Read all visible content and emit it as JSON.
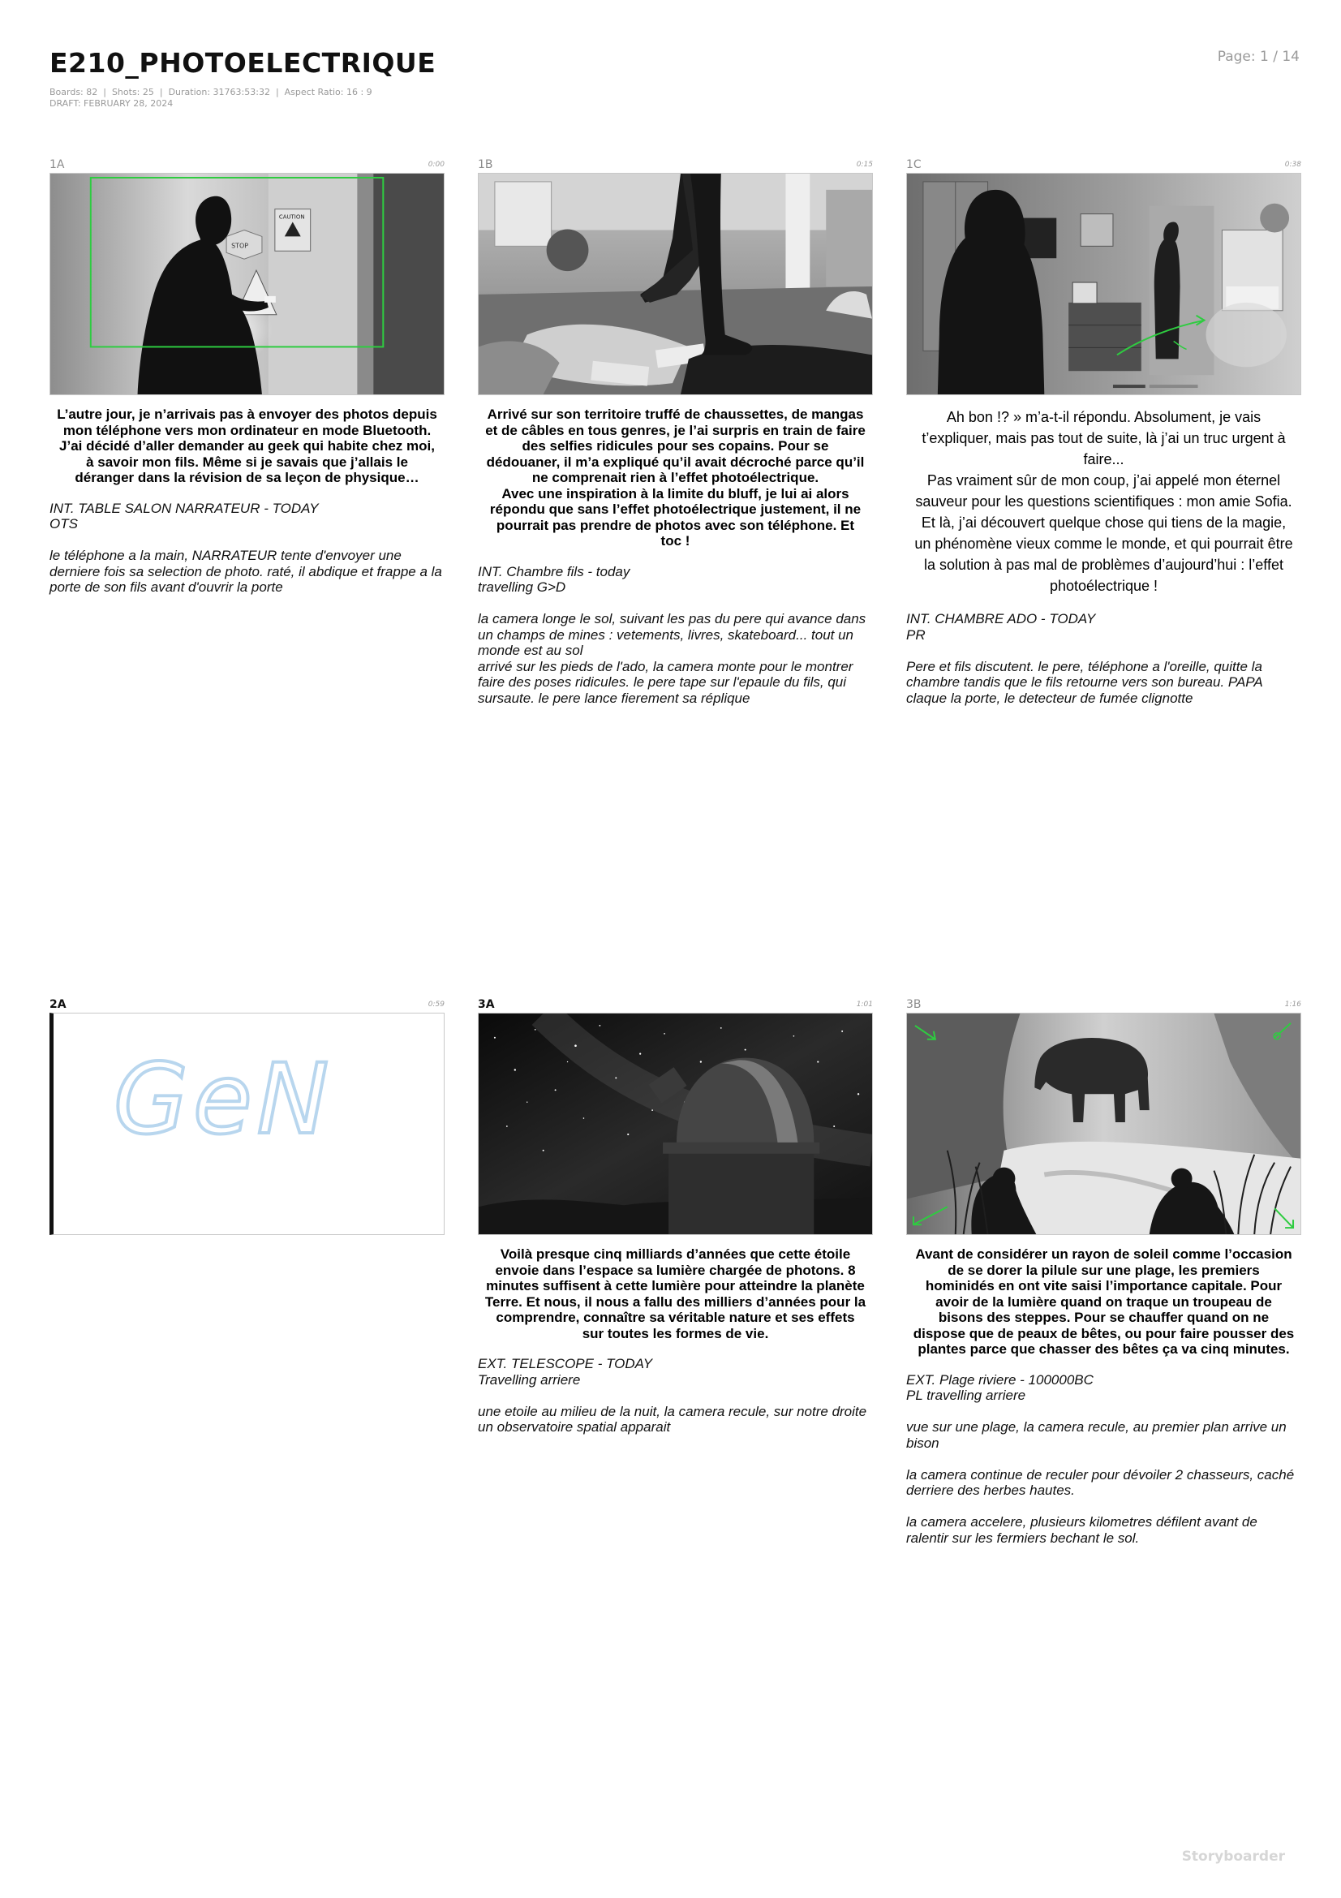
{
  "document": {
    "title": "E210_PHOTOELECTRIQUE",
    "meta_line": "Boards: 82  |  Shots: 25  |  Duration: 31763:53:32  |  Aspect Ratio: 16 : 9",
    "draft_line": "DRAFT: FEBRUARY 28, 2024",
    "page": "Page: 1 / 14",
    "brand": "Storyboarder"
  },
  "boards": [
    {
      "number": "1A",
      "time": "0:00",
      "dialogue": "L’autre jour, je n’arrivais pas à envoyer des photos depuis mon téléphone vers mon ordinateur en mode Bluetooth. J’ai décidé d’aller demander au geek qui habite chez moi, à savoir mon fils. Même si je savais que j’allais le déranger dans la révision de sa leçon de physique…",
      "action": [
        "INT. TABLE SALON NARRATEUR - TODAY\nOTS",
        "le téléphone a la main, NARRATEUR tente d'envoyer une derniere fois sa selection de photo. raté, il abdique et frappe a la porte de son fils avant d'ouvrir la porte"
      ],
      "image_text": [
        "CAUTION",
        "STOP"
      ]
    },
    {
      "number": "1B",
      "time": "0:15",
      "dialogue": "Arrivé sur son territoire truffé de chaussettes, de mangas et de câbles en tous genres, je l’ai surpris en train de faire des selfies ridicules pour ses copains. Pour se dédouaner, il m’a expliqué qu’il avait décroché parce qu’il ne comprenait rien à l’effet photoélectrique.\nAvec une inspiration à la limite du bluff, je lui ai alors répondu que sans l’effet photoélectrique justement, il ne pourrait pas prendre de photos avec son téléphone. Et toc !",
      "action": [
        "INT. Chambre fils - today\ntravelling G>D",
        "la camera longe le sol, suivant les pas du pere qui avance dans un champs de mines : vetements, livres, skateboard... tout un monde est au sol\narrivé sur les pieds de l'ado, la camera monte pour le montrer faire des poses ridicules. le pere tape sur l'epaule du fils, qui sursaute. le pere lance fierement sa réplique"
      ]
    },
    {
      "number": "1C",
      "time": "0:38",
      "dialogue": "Ah bon !? » m’a-t-il répondu. Absolument, je vais t’expliquer, mais pas tout de suite, là j’ai un truc urgent à faire...\nPas vraiment sûr de mon coup, j’ai appelé mon éternel sauveur pour les questions scientifiques : mon amie Sofia. Et là, j’ai découvert quelque chose qui tiens de la magie, un phénomène vieux comme le monde, et qui pourrait être la solution à pas mal de problèmes d’aujourd’hui : l’effet photoélectrique !",
      "action": [
        "INT. CHAMBRE ADO - TODAY\nPR",
        "Pere et fils discutent. le pere, téléphone a l'oreille, quitte la chambre tandis que le fils retourne vers son bureau. PAPA claque la porte, le detecteur de fumée clignotte"
      ]
    },
    {
      "number": "2A",
      "time": "0:59",
      "dialogue": "",
      "action": [],
      "image_text": [
        "GeN"
      ]
    },
    {
      "number": "3A",
      "time": "1:01",
      "dialogue": "Voilà presque cinq milliards d’années que cette étoile envoie dans l’espace sa lumière chargée de photons. 8 minutes suffisent à cette lumière pour atteindre la planète Terre. Et nous, il nous a fallu des milliers d’années pour la comprendre, connaître sa véritable nature et ses effets sur toutes les formes de vie.",
      "action": [
        "EXT. TELESCOPE - TODAY\nTravelling arriere",
        "une etoile au milieu de la nuit, la camera recule, sur notre droite un observatoire spatial apparait"
      ]
    },
    {
      "number": "3B",
      "time": "1:16",
      "dialogue": "Avant de considérer un rayon de soleil comme l’occasion de se dorer la pilule sur une plage, les premiers hominidés en ont vite saisi l’importance capitale. Pour avoir de la lumière quand on traque un troupeau de bisons des steppes. Pour se chauffer quand on ne dispose que de peaux de bêtes, ou pour faire pousser des plantes parce que chasser des bêtes ça va cinq minutes.",
      "action": [
        "EXT. Plage riviere - 100000BC\nPL travelling arriere",
        "vue sur une plage, la camera recule, au premier plan arrive un\nbison",
        "la camera continue de reculer pour dévoiler 2 chasseurs, caché derriere des herbes hautes.",
        "la camera accelere, plusieurs kilometres défilent avant de ralentir sur les fermiers bechant le sol."
      ]
    }
  ]
}
